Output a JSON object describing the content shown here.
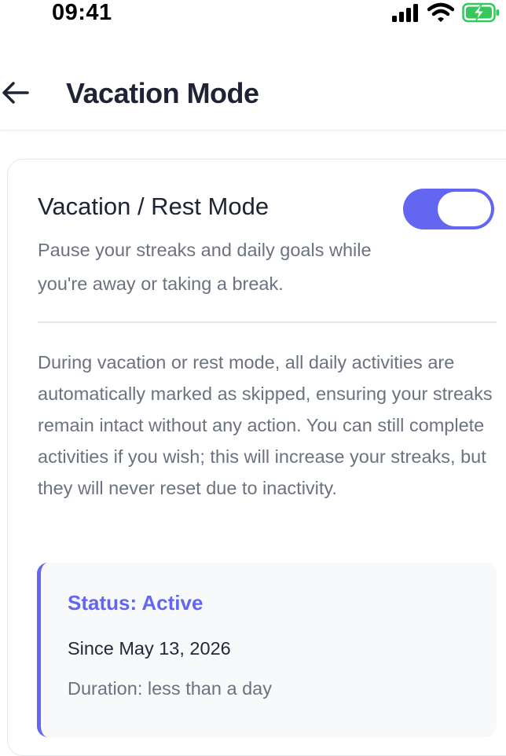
{
  "status_bar": {
    "time": "09:41"
  },
  "header": {
    "title": "Vacation Mode"
  },
  "card": {
    "title": "Vacation / Rest Mode",
    "toggle_on": true,
    "subtitle": "Pause your streaks and daily goals while you're away or taking a break.",
    "description": "During vacation or rest mode, all daily activities are automatically marked as skipped, ensuring your streaks remain intact without any action. You can still complete activities if you wish; this will increase your streaks, but they will never reset due to inactivity.",
    "status": {
      "label": "Status: Active",
      "since": "Since May 13, 2026",
      "duration": "Duration: less than a day"
    }
  },
  "colors": {
    "accent": "#6366f1",
    "title_text": "#1e2433",
    "muted_text": "#6b7280",
    "battery_green": "#34c759"
  }
}
